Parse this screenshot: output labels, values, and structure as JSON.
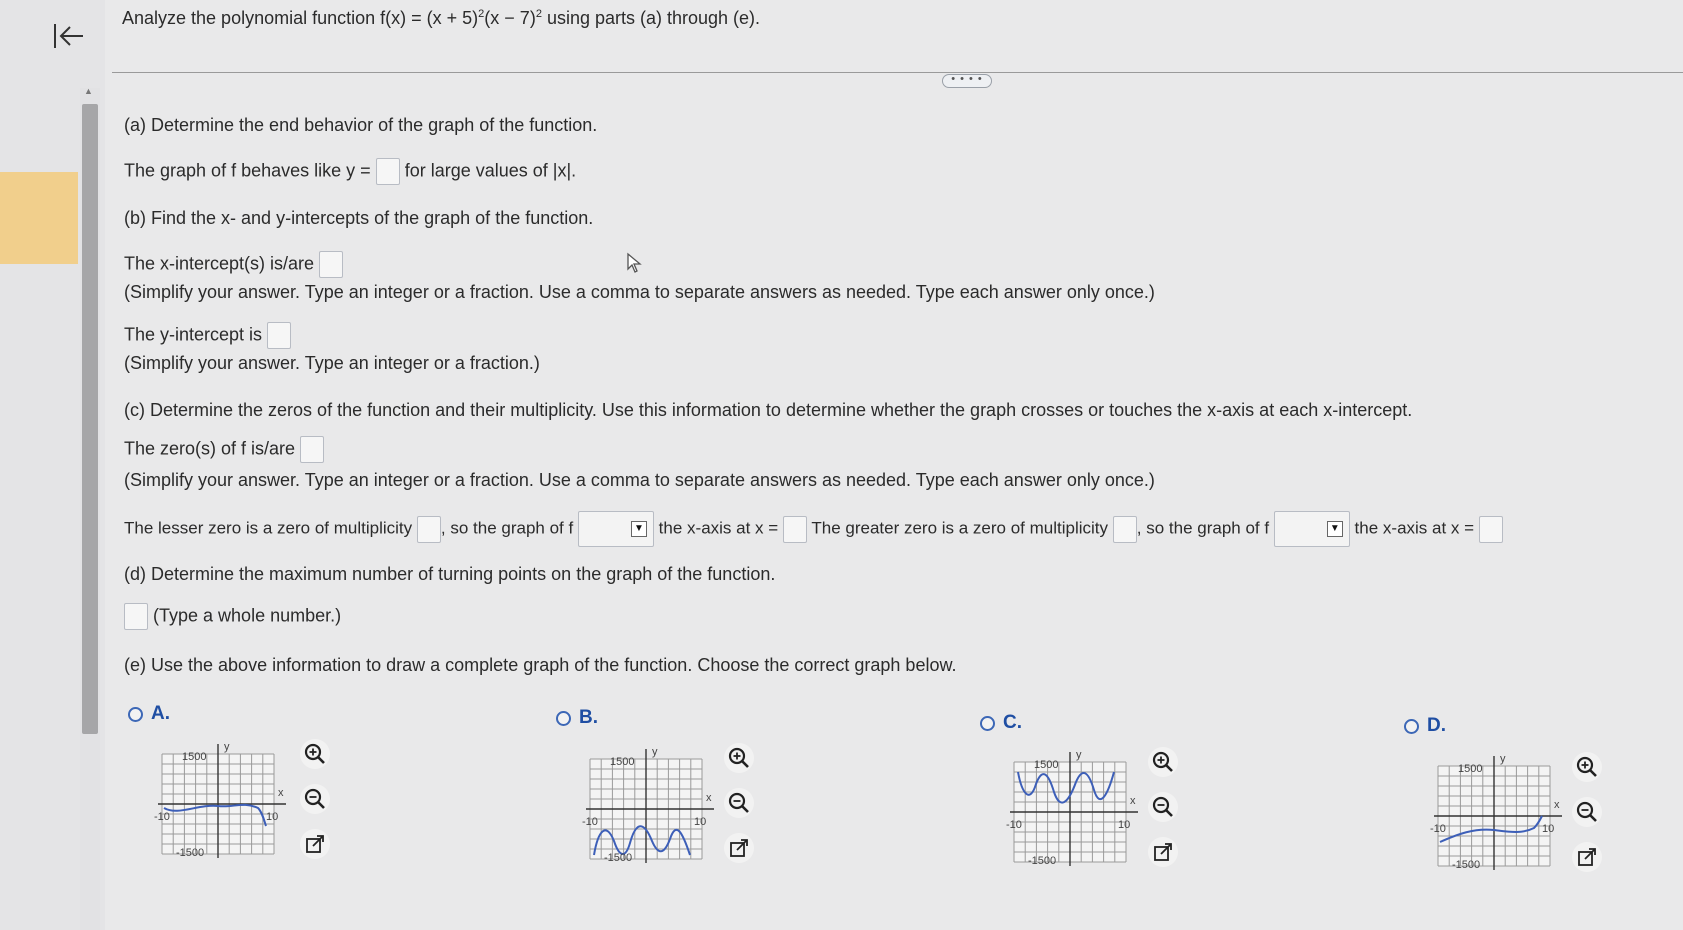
{
  "question": {
    "prefix": "Analyze the polynomial function f(x) = (x + 5)",
    "exp1": "2",
    "middle": "(x − 7)",
    "exp2": "2",
    "suffix": " using parts (a) through (e)."
  },
  "more_label": "• • • •",
  "part_a": {
    "heading": "(a) Determine the end behavior of the graph of the function.",
    "line_prefix": "The graph of f behaves like y =",
    "line_suffix": "for large values of |x|."
  },
  "part_b": {
    "heading": "(b) Find the x- and y-intercepts of the graph of the function.",
    "x_intercept_label": "The x-intercept(s) is/are",
    "x_intercept_hint": "(Simplify your answer. Type an integer or a fraction. Use a comma to separate answers as needed. Type each answer only once.)",
    "y_intercept_label": "The y-intercept is",
    "y_intercept_hint": "(Simplify your answer. Type an integer or a fraction.)"
  },
  "part_c": {
    "heading": "(c) Determine the zeros of the function and their multiplicity. Use this information to determine whether the graph crosses or touches the x-axis at each x-intercept.",
    "zeros_label": "The zero(s) of f is/are",
    "zeros_hint": "(Simplify your answer. Type an integer or a fraction. Use a comma to separate answers as needed. Type each answer only once.)",
    "lesser_prefix": "The lesser zero is a zero of multiplicity",
    "so_graph": ", so the graph of f",
    "axis_at": "the x-axis at x =",
    "greater_prefix": "The greater zero is a zero of multiplicity"
  },
  "part_d": {
    "heading": "(d) Determine the maximum number of turning points on the graph of the function.",
    "hint": "(Type a whole number.)"
  },
  "part_e": {
    "heading": "(e) Use the above information to draw a complete graph of the function. Choose the correct graph below."
  },
  "options": [
    {
      "label": "A."
    },
    {
      "label": "B."
    },
    {
      "label": "C."
    },
    {
      "label": "D."
    }
  ],
  "graph_labels": {
    "y_top": "1500",
    "y_bottom": "-1500",
    "x_left": "-10",
    "x_right": "10",
    "x_axis": "x",
    "y_axis": "y"
  },
  "colors": {
    "radio": "#3c67b6",
    "curve": "#3d5fb8",
    "grid": "#9a9a9a"
  }
}
